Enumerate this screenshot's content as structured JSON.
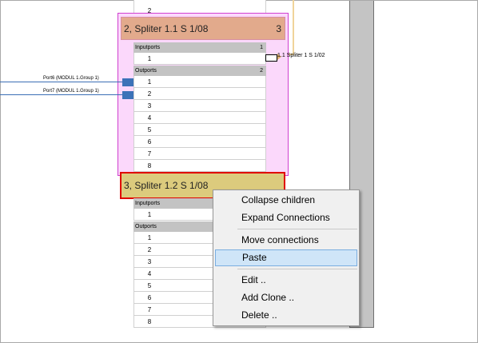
{
  "node2": {
    "title": "2, Spliter 1.1 S 1/08",
    "number": "3",
    "inputports": {
      "label": "Inputports",
      "count": "1",
      "rows": [
        "1"
      ]
    },
    "outputports": {
      "label": "Outports",
      "count": "2",
      "rows": [
        "1",
        "2",
        "3",
        "4",
        "5",
        "6",
        "7",
        "8"
      ]
    }
  },
  "node3": {
    "title": "3, Spliter 1.2 S 1/08",
    "inputports": {
      "label": "Inputports",
      "rows": [
        "1"
      ]
    },
    "outputports": {
      "label": "Outports",
      "rows": [
        "1",
        "2",
        "3",
        "4",
        "5",
        "6",
        "7",
        "8"
      ]
    }
  },
  "top_rows": [
    "2"
  ],
  "wires": {
    "port6_label": "Port6 (MODUL 1.Group 1)",
    "port7_label": "Port7 (MODUL 1.Group 1)"
  },
  "connection_label": "1.1 Spliter 1 S 1/02",
  "context_menu": {
    "items": [
      "Collapse children",
      "Expand Connections",
      "Move connections",
      "Paste",
      "Edit ..",
      "Add Clone  ..",
      "Delete .."
    ],
    "highlighted": "Paste"
  },
  "colors": {
    "node2_bg": "#fbd8fb",
    "node2_title": "#e2aa8c",
    "node3_title": "#dccb7d",
    "selection_border": "#e00000",
    "wire": "#3b6fb5",
    "menu_highlight": "#cfe5f8"
  }
}
